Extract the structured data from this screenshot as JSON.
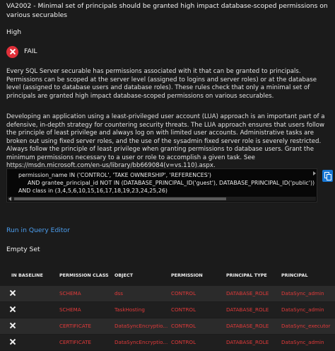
{
  "rule": {
    "title": "VA2002 - Minimal set of principals should be granted high impact database-scoped permissions on various securables",
    "severity": "High",
    "status": "FAIL",
    "status_icon": "fail-x-icon",
    "status_color": "#e0303a"
  },
  "description": [
    "Every SQL Server securable has permissions associated with it that can be granted to principals. Permissions can be scoped at the server level (assigned to logins and server roles) or at the database level (assigned to database users and database roles). These rules check that only a minimal set of principals are granted high impact database-scoped permissions on various securables.",
    "Developing an application using a least-privileged user account (LUA) approach is an important part of a defensive, in-depth strategy for countering security threats. The LUA approach ensures that users follow the principle of least privilege and always log on with limited user accounts. Administrative tasks are broken out using fixed server roles, and the use of the sysadmin fixed server role is severely restricted. Always follow the principle of least privilege when granting permissions to database users. Grant the minimum permissions necessary to a user or role to accomplish a given task. See https://msdn.microsoft.com/en-us/library/bb669084(v=vs.110).aspx."
  ],
  "query": {
    "lines": [
      "permission_name IN ('CONTROL', 'TAKE OWNERSHIP', 'REFERENCES')",
      "AND grantee_principal_id NOT IN (DATABASE_PRINCIPAL_ID('guest'), DATABASE_PRINCIPAL_ID('public'))",
      "AND class in (3,4,5,6,10,15,16,17,18,19,23,24,25,26)"
    ],
    "copy_icon": "copy-icon"
  },
  "actions": {
    "run_label": "Run in Query Editor"
  },
  "results": {
    "empty_label": "Empty Set",
    "columns": [
      "IN BASELINE",
      "PERMISSION CLASS",
      "OBJECT",
      "PERMISSION",
      "PRINCIPAL TYPE",
      "PRINCIPAL"
    ],
    "rows": [
      [
        "SCHEMA",
        "dss",
        "CONTROL",
        "DATABASE_ROLE",
        "DataSync_admin"
      ],
      [
        "SCHEMA",
        "TaskHosting",
        "CONTROL",
        "DATABASE_ROLE",
        "DataSync_admin"
      ],
      [
        "CERTIFICATE",
        "DataSyncEncryptio...",
        "CONTROL",
        "DATABASE_ROLE",
        "DataSync_executor"
      ],
      [
        "CERTIFICATE",
        "DataSyncEncryptio...",
        "CONTROL",
        "DATABASE_ROLE",
        "DataSync_admin"
      ]
    ],
    "baseline_icon": "x-mark-icon",
    "value_color": "#e23a3a"
  }
}
